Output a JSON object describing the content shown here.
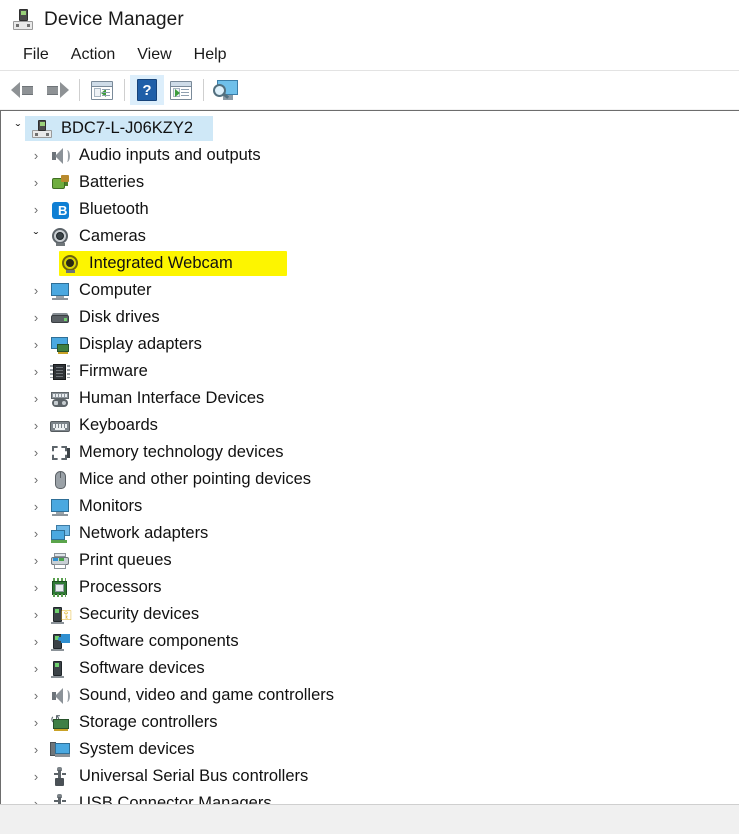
{
  "window": {
    "title": "Device Manager",
    "app_icon": "device-manager-icon"
  },
  "menu": {
    "items": [
      {
        "label": "File"
      },
      {
        "label": "Action"
      },
      {
        "label": "View"
      },
      {
        "label": "Help"
      }
    ]
  },
  "toolbar": {
    "buttons": [
      {
        "name": "back-button",
        "icon": "back-arrow-icon",
        "active": false
      },
      {
        "name": "forward-button",
        "icon": "forward-arrow-icon",
        "active": false
      },
      {
        "name": "show-hide-console-tree-button",
        "icon": "console-tree-icon",
        "active": false
      },
      {
        "name": "help-button",
        "icon": "help-question-icon",
        "glyph": "?",
        "active": true
      },
      {
        "name": "properties-button",
        "icon": "properties-panel-icon",
        "active": false
      },
      {
        "name": "scan-for-hardware-changes-button",
        "icon": "monitor-search-icon",
        "active": false
      }
    ]
  },
  "tree": {
    "root": {
      "label": "BDC7-L-J06KZY2",
      "icon": "computer-device-icon",
      "expanded": true,
      "selected": true
    },
    "nodes": [
      {
        "label": "Audio inputs and outputs",
        "icon": "speaker-icon",
        "expanded": false,
        "highlighted": false
      },
      {
        "label": "Batteries",
        "icon": "battery-icon",
        "expanded": false,
        "highlighted": false
      },
      {
        "label": "Bluetooth",
        "icon": "bluetooth-icon",
        "expanded": false,
        "highlighted": false
      },
      {
        "label": "Cameras",
        "icon": "camera-icon",
        "expanded": true,
        "highlighted": false,
        "children": [
          {
            "label": "Integrated Webcam",
            "icon": "camera-icon",
            "highlighted": true
          }
        ]
      },
      {
        "label": "Computer",
        "icon": "monitor-icon",
        "expanded": false,
        "highlighted": false
      },
      {
        "label": "Disk drives",
        "icon": "disk-drive-icon",
        "expanded": false,
        "highlighted": false
      },
      {
        "label": "Display adapters",
        "icon": "display-adapter-icon",
        "expanded": false,
        "highlighted": false
      },
      {
        "label": "Firmware",
        "icon": "firmware-chip-icon",
        "expanded": false,
        "highlighted": false
      },
      {
        "label": "Human Interface Devices",
        "icon": "human-interface-device-icon",
        "expanded": false,
        "highlighted": false
      },
      {
        "label": "Keyboards",
        "icon": "keyboard-icon",
        "expanded": false,
        "highlighted": false
      },
      {
        "label": "Memory technology devices",
        "icon": "memory-technology-icon",
        "expanded": false,
        "highlighted": false
      },
      {
        "label": "Mice and other pointing devices",
        "icon": "mouse-icon",
        "expanded": false,
        "highlighted": false
      },
      {
        "label": "Monitors",
        "icon": "monitor-icon",
        "expanded": false,
        "highlighted": false
      },
      {
        "label": "Network adapters",
        "icon": "network-adapter-icon",
        "expanded": false,
        "highlighted": false
      },
      {
        "label": "Print queues",
        "icon": "printer-icon",
        "expanded": false,
        "highlighted": false
      },
      {
        "label": "Processors",
        "icon": "processor-icon",
        "expanded": false,
        "highlighted": false
      },
      {
        "label": "Security devices",
        "icon": "security-device-icon",
        "expanded": false,
        "highlighted": false
      },
      {
        "label": "Software components",
        "icon": "software-component-icon",
        "expanded": false,
        "highlighted": false
      },
      {
        "label": "Software devices",
        "icon": "software-device-icon",
        "expanded": false,
        "highlighted": false
      },
      {
        "label": "Sound, video and game controllers",
        "icon": "speaker-icon",
        "expanded": false,
        "highlighted": false
      },
      {
        "label": "Storage controllers",
        "icon": "storage-controller-icon",
        "expanded": false,
        "highlighted": false
      },
      {
        "label": "System devices",
        "icon": "system-device-icon",
        "expanded": false,
        "highlighted": false
      },
      {
        "label": "Universal Serial Bus controllers",
        "icon": "usb-icon",
        "expanded": false,
        "highlighted": false
      },
      {
        "label": "USB Connector Managers",
        "icon": "usb-icon",
        "expanded": false,
        "highlighted": false
      }
    ],
    "expand_collapsed_glyph": "›",
    "expand_expanded_glyph": "ˇ"
  },
  "colors": {
    "selection": "#cfe8f7",
    "marker_highlight": "#fdf500",
    "toolbar_active": "#dceefb"
  }
}
